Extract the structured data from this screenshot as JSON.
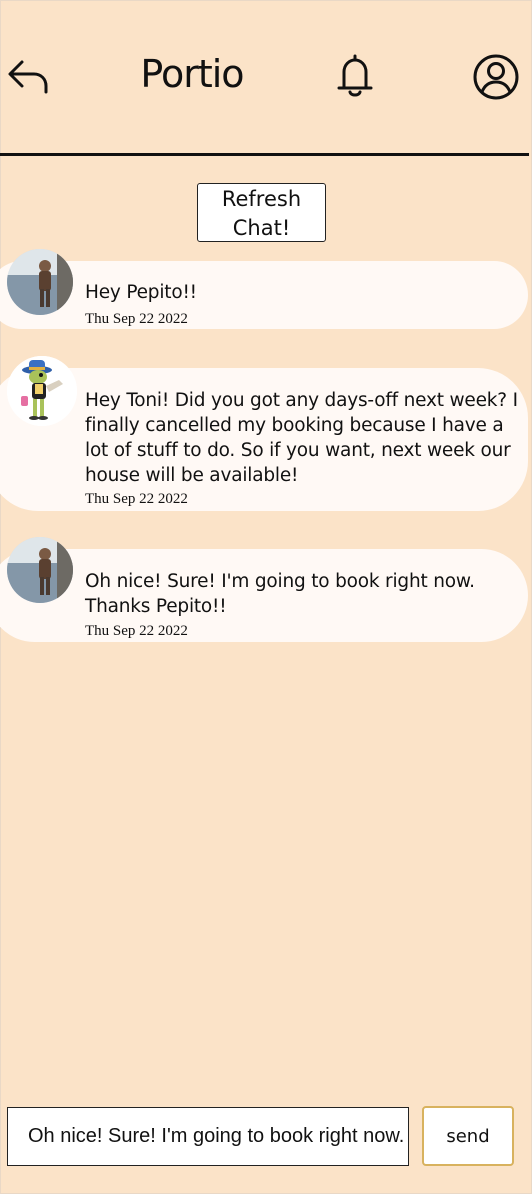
{
  "header": {
    "brand": "Portio",
    "back_icon": "back-arrow-icon",
    "notification_icon": "bell-icon",
    "profile_icon": "user-circle-icon"
  },
  "refresh_button": {
    "label_line1": "Refresh",
    "label_line2": "Chat!"
  },
  "messages": [
    {
      "text": "Hey Pepito!!",
      "date": "Thu Sep 22 2022",
      "avatar": "user-photo-avatar"
    },
    {
      "text": "Hey Toni! Did you got any days-off next week? I finally cancelled my booking because I have a lot of stuff to do. So if you want, next week our house will be available!",
      "date": "Thu Sep 22 2022",
      "avatar": "cartoon-cricket-avatar"
    },
    {
      "text": "Oh nice! Sure! I'm going to book right now. Thanks Pepito!!",
      "date": "Thu Sep 22 2022",
      "avatar": "user-photo-avatar"
    }
  ],
  "composer": {
    "value": "Oh nice! Sure! I'm going to book right now. Thanks Pepito!!",
    "send_label": "send"
  },
  "colors": {
    "background": "#fbe3c8",
    "bubble": "#fff9f5",
    "send_border": "#d8b25e"
  }
}
